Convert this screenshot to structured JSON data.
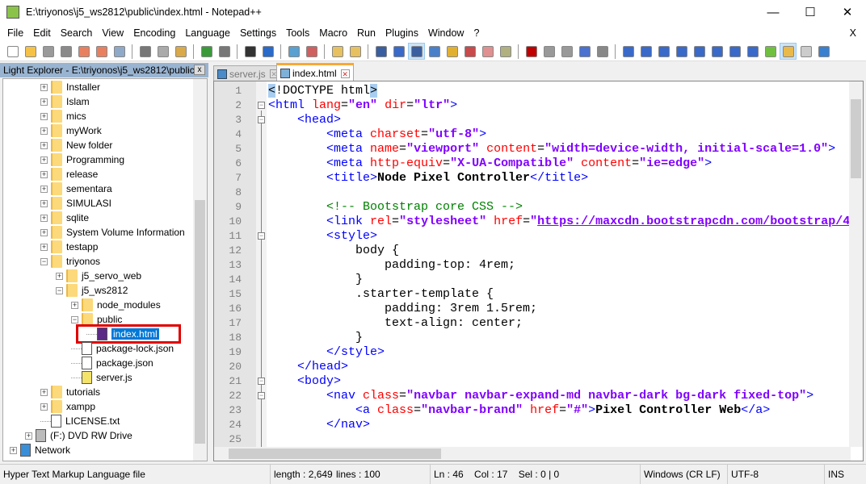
{
  "window": {
    "title": "E:\\triyonos\\j5_ws2812\\public\\index.html - Notepad++",
    "minimize": "—",
    "maximize": "☐",
    "close": "✕"
  },
  "menu": {
    "items": [
      "File",
      "Edit",
      "Search",
      "View",
      "Encoding",
      "Language",
      "Settings",
      "Tools",
      "Macro",
      "Run",
      "Plugins",
      "Window",
      "?"
    ],
    "close_doc": "X"
  },
  "toolbar": {
    "icons": [
      {
        "name": "new-file",
        "color": "#ffffff"
      },
      {
        "name": "open-file",
        "color": "#f5c146"
      },
      {
        "name": "save",
        "color": "#9a9a9a"
      },
      {
        "name": "save-all",
        "color": "#8a8a8a"
      },
      {
        "name": "close",
        "color": "#e88060"
      },
      {
        "name": "close-all",
        "color": "#e88060"
      },
      {
        "name": "print",
        "color": "#8fa9c9"
      },
      "|",
      {
        "name": "cut",
        "color": "#777777"
      },
      {
        "name": "copy",
        "color": "#aaaaaa"
      },
      {
        "name": "paste",
        "color": "#d9a94a"
      },
      "|",
      {
        "name": "undo",
        "color": "#3a9a3a"
      },
      {
        "name": "redo",
        "color": "#777777"
      },
      "|",
      {
        "name": "find",
        "color": "#333333"
      },
      {
        "name": "replace",
        "color": "#2a6ac9"
      },
      "|",
      {
        "name": "zoom-in",
        "color": "#5aa0d0"
      },
      {
        "name": "zoom-out",
        "color": "#d06060"
      },
      "|",
      {
        "name": "sync-vertical",
        "color": "#e7c060"
      },
      {
        "name": "sync-horizontal",
        "color": "#e7c060"
      },
      "|",
      {
        "name": "word-wrap",
        "color": "#3a5fa0"
      },
      {
        "name": "show-all-characters",
        "color": "#3a6ac9"
      },
      {
        "name": "indent-guide",
        "color": "#3a5fa0",
        "active": true
      },
      {
        "name": "user-defined-language",
        "color": "#4a80c9"
      },
      {
        "name": "document-map",
        "color": "#e2b030"
      },
      {
        "name": "function-list",
        "color": "#c94a4a"
      },
      {
        "name": "folder-as-workspace",
        "color": "#e09090"
      },
      {
        "name": "monitoring",
        "color": "#b0b080"
      },
      "|",
      {
        "name": "record-macro",
        "color": "#c00000"
      },
      {
        "name": "stop-recording",
        "color": "#999999"
      },
      {
        "name": "play-macro",
        "color": "#999999"
      },
      {
        "name": "run-macro-multiple",
        "color": "#4a70d0"
      },
      {
        "name": "save-macro",
        "color": "#888888"
      },
      "|",
      {
        "name": "bookmark",
        "color": "#3a6ac9"
      },
      {
        "name": "compare",
        "color": "#3a6ac9"
      },
      {
        "name": "compare-clear",
        "color": "#3a6ac9"
      },
      {
        "name": "first-diff",
        "color": "#3a6ac9"
      },
      {
        "name": "previous-diff",
        "color": "#3a6ac9"
      },
      {
        "name": "next-diff",
        "color": "#3a6ac9"
      },
      {
        "name": "last-diff",
        "color": "#3a6ac9"
      },
      {
        "name": "diff-bar",
        "color": "#3a6ac9"
      },
      {
        "name": "blocks",
        "color": "#70c040"
      },
      {
        "name": "light-explorer",
        "color": "#e9b949",
        "active": true
      },
      {
        "name": "file-list",
        "color": "#cccccc"
      },
      {
        "name": "preview",
        "color": "#3a80d0"
      }
    ]
  },
  "explorer": {
    "title": "Light Explorer - E:\\triyonos\\j5_ws2812\\public\\",
    "close": "x",
    "items": [
      {
        "label": "Installer",
        "level": 3,
        "type": "folder",
        "expander": "+"
      },
      {
        "label": "Islam",
        "level": 3,
        "type": "folder",
        "expander": "+"
      },
      {
        "label": "mics",
        "level": 3,
        "type": "folder",
        "expander": "+"
      },
      {
        "label": "myWork",
        "level": 3,
        "type": "folder",
        "expander": "+"
      },
      {
        "label": "New folder",
        "level": 3,
        "type": "folder",
        "expander": "+"
      },
      {
        "label": "Programming",
        "level": 3,
        "type": "folder",
        "expander": "+"
      },
      {
        "label": "release",
        "level": 3,
        "type": "folder",
        "expander": "+"
      },
      {
        "label": "sementara",
        "level": 3,
        "type": "folder",
        "expander": "+"
      },
      {
        "label": "SIMULASI",
        "level": 3,
        "type": "folder",
        "expander": "+"
      },
      {
        "label": "sqlite",
        "level": 3,
        "type": "folder",
        "expander": "+"
      },
      {
        "label": "System Volume Information",
        "level": 3,
        "type": "folder",
        "expander": "+"
      },
      {
        "label": "testapp",
        "level": 3,
        "type": "folder",
        "expander": "+"
      },
      {
        "label": "triyonos",
        "level": 3,
        "type": "folder",
        "expander": "−"
      },
      {
        "label": "j5_servo_web",
        "level": 4,
        "type": "folder",
        "expander": "+"
      },
      {
        "label": "j5_ws2812",
        "level": 4,
        "type": "folder",
        "expander": "−"
      },
      {
        "label": "node_modules",
        "level": 5,
        "type": "folder",
        "expander": "+"
      },
      {
        "label": "public",
        "level": 5,
        "type": "folder",
        "expander": "−"
      },
      {
        "label": "index.html",
        "level": 6,
        "type": "html",
        "selected": true
      },
      {
        "label": "package-lock.json",
        "level": 5,
        "type": "json"
      },
      {
        "label": "package.json",
        "level": 5,
        "type": "json"
      },
      {
        "label": "server.js",
        "level": 5,
        "type": "js"
      },
      {
        "label": "tutorials",
        "level": 3,
        "type": "folder",
        "expander": "+"
      },
      {
        "label": "xampp",
        "level": 3,
        "type": "folder",
        "expander": "+"
      },
      {
        "label": "LICENSE.txt",
        "level": 3,
        "type": "text"
      },
      {
        "label": "(F:) DVD RW Drive",
        "level": 2,
        "type": "drive",
        "expander": "+"
      },
      {
        "label": "Network",
        "level": 1,
        "type": "network",
        "expander": "+"
      }
    ]
  },
  "tabs": [
    {
      "label": "server.js",
      "active": false
    },
    {
      "label": "index.html",
      "active": true
    }
  ],
  "editor": {
    "lines": [
      [
        [
          "bm",
          "<"
        ],
        [
          "d",
          "!DOCTYPE html"
        ],
        [
          "bm",
          ">"
        ]
      ],
      [
        [
          "t",
          "<html"
        ],
        [
          "a",
          " lang"
        ],
        [
          "p",
          "="
        ],
        [
          "v",
          "\"en\""
        ],
        [
          "a",
          " dir"
        ],
        [
          "p",
          "="
        ],
        [
          "v",
          "\"ltr\""
        ],
        [
          "t",
          ">"
        ]
      ],
      [
        [
          "p",
          "    "
        ],
        [
          "t",
          "<head>"
        ]
      ],
      [
        [
          "p",
          "        "
        ],
        [
          "t",
          "<meta"
        ],
        [
          "a",
          " charset"
        ],
        [
          "p",
          "="
        ],
        [
          "v",
          "\"utf-8\""
        ],
        [
          "t",
          ">"
        ]
      ],
      [
        [
          "p",
          "        "
        ],
        [
          "t",
          "<meta"
        ],
        [
          "a",
          " name"
        ],
        [
          "p",
          "="
        ],
        [
          "v",
          "\"viewport\""
        ],
        [
          "a",
          " content"
        ],
        [
          "p",
          "="
        ],
        [
          "v",
          "\"width=device-width, initial-scale=1.0\""
        ],
        [
          "t",
          ">"
        ]
      ],
      [
        [
          "p",
          "        "
        ],
        [
          "t",
          "<meta"
        ],
        [
          "a",
          " http-equiv"
        ],
        [
          "p",
          "="
        ],
        [
          "v",
          "\"X-UA-Compatible\""
        ],
        [
          "a",
          " content"
        ],
        [
          "p",
          "="
        ],
        [
          "v",
          "\"ie=edge\""
        ],
        [
          "t",
          ">"
        ]
      ],
      [
        [
          "p",
          "        "
        ],
        [
          "t",
          "<title>"
        ],
        [
          "x",
          "Node Pixel Controller"
        ],
        [
          "t",
          "</title>"
        ]
      ],
      [],
      [
        [
          "p",
          "        "
        ],
        [
          "c",
          "<!-- Bootstrap core CSS -->"
        ]
      ],
      [
        [
          "p",
          "        "
        ],
        [
          "t",
          "<link"
        ],
        [
          "a",
          " rel"
        ],
        [
          "p",
          "="
        ],
        [
          "v",
          "\"stylesheet\""
        ],
        [
          "a",
          " href"
        ],
        [
          "p",
          "="
        ],
        [
          "v",
          "\""
        ],
        [
          "u",
          "https://maxcdn.bootstrapcdn.com/bootstrap/4"
        ]
      ],
      [
        [
          "p",
          "        "
        ],
        [
          "t",
          "<style>"
        ]
      ],
      [
        [
          "p",
          "            body {"
        ]
      ],
      [
        [
          "p",
          "                padding-top: 4rem;"
        ]
      ],
      [
        [
          "p",
          "            }"
        ]
      ],
      [
        [
          "p",
          "            .starter-template {"
        ]
      ],
      [
        [
          "p",
          "                padding: 3rem 1.5rem;"
        ]
      ],
      [
        [
          "p",
          "                text-align: center;"
        ]
      ],
      [
        [
          "p",
          "            }"
        ]
      ],
      [
        [
          "p",
          "        "
        ],
        [
          "t",
          "</style>"
        ]
      ],
      [
        [
          "p",
          "    "
        ],
        [
          "t",
          "</head>"
        ]
      ],
      [
        [
          "p",
          "    "
        ],
        [
          "t",
          "<body>"
        ]
      ],
      [
        [
          "p",
          "        "
        ],
        [
          "t",
          "<nav"
        ],
        [
          "a",
          " class"
        ],
        [
          "p",
          "="
        ],
        [
          "v",
          "\"navbar navbar-expand-md navbar-dark bg-dark fixed-top\""
        ],
        [
          "t",
          ">"
        ]
      ],
      [
        [
          "p",
          "            "
        ],
        [
          "t",
          "<a"
        ],
        [
          "a",
          " class"
        ],
        [
          "p",
          "="
        ],
        [
          "v",
          "\"navbar-brand\""
        ],
        [
          "a",
          " href"
        ],
        [
          "p",
          "="
        ],
        [
          "v",
          "\"#\""
        ],
        [
          "t",
          ">"
        ],
        [
          "x",
          "Pixel Controller Web"
        ],
        [
          "t",
          "</a>"
        ]
      ],
      [
        [
          "p",
          "        "
        ],
        [
          "t",
          "</nav>"
        ]
      ],
      []
    ],
    "fold_lines": [
      2,
      3,
      11,
      21,
      22
    ]
  },
  "status": {
    "file_type": "Hyper Text Markup Language file",
    "length": "length : 2,649",
    "lines": "lines : 100",
    "position": "Ln : 46    Col : 17    Sel : 0 | 0",
    "eol": "Windows (CR LF)",
    "encoding": "UTF-8",
    "mode": "INS"
  }
}
